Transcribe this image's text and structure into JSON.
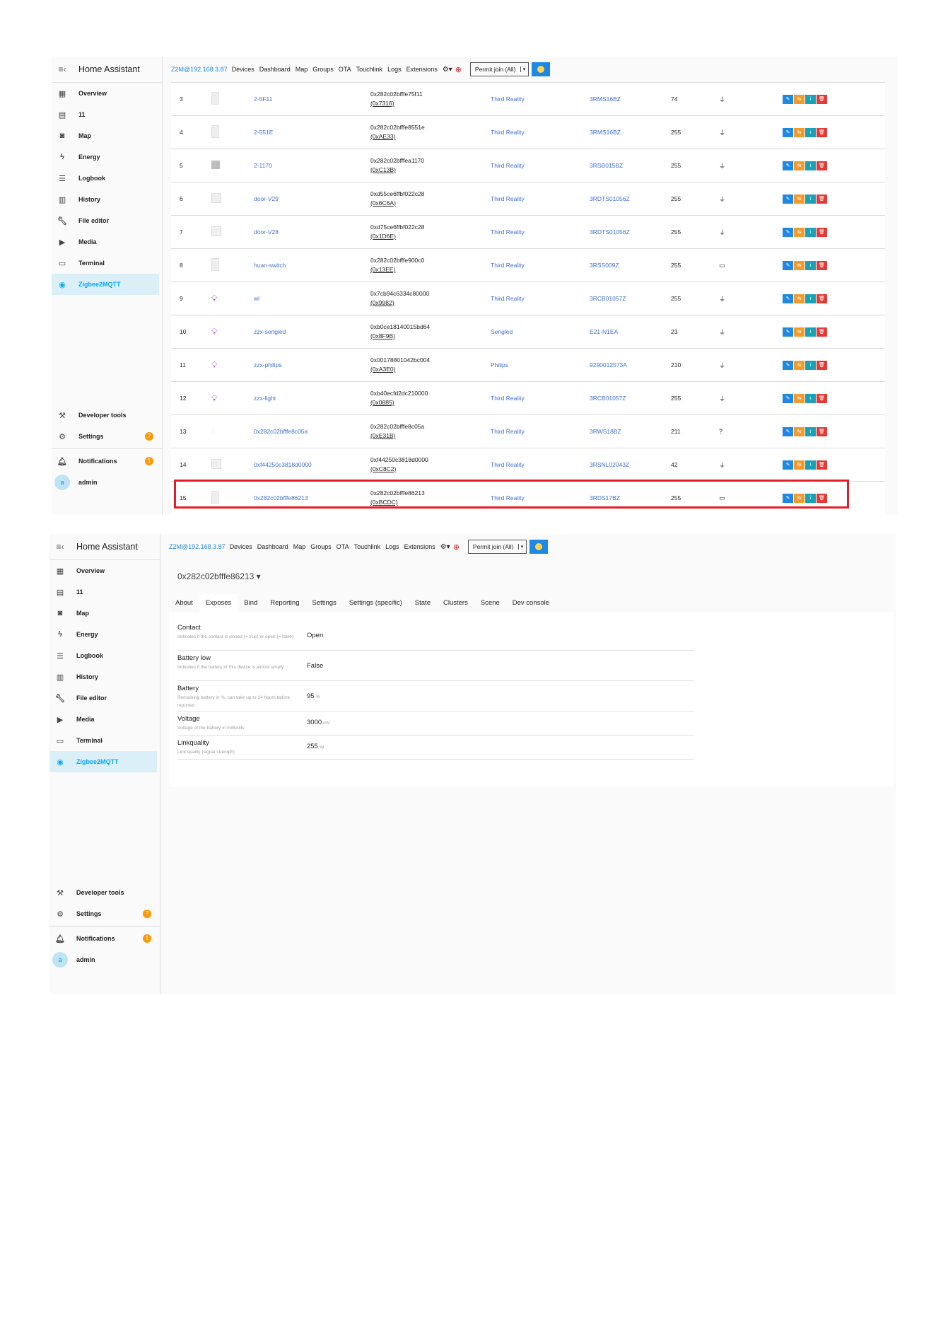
{
  "app": {
    "title": "Home Assistant",
    "brand": "Z2M@192.168.3.87",
    "nav": [
      "Devices",
      "Dashboard",
      "Map",
      "Groups",
      "OTA",
      "Touchlink",
      "Logs",
      "Extensions"
    ],
    "permit_join": "Permit join (All)"
  },
  "sidebar": {
    "items": [
      {
        "label": "Overview",
        "icon": "dashboard-icon"
      },
      {
        "label": "11",
        "icon": "notebook-icon"
      },
      {
        "label": "Map",
        "icon": "map-icon"
      },
      {
        "label": "Energy",
        "icon": "lightning-icon"
      },
      {
        "label": "Logbook",
        "icon": "list-icon"
      },
      {
        "label": "History",
        "icon": "chart-icon"
      },
      {
        "label": "File editor",
        "icon": "wrench-icon"
      },
      {
        "label": "Media",
        "icon": "media-icon"
      },
      {
        "label": "Terminal",
        "icon": "terminal-icon"
      },
      {
        "label": "Zigbee2MQTT",
        "icon": "zigbee-icon"
      }
    ],
    "developer_tools": "Developer tools",
    "settings": "Settings",
    "settings_badge": "?",
    "notifications": "Notifications",
    "notifications_badge": "1",
    "user": "admin",
    "avatar_letter": "a"
  },
  "devices": [
    {
      "idx": "3",
      "pic": "box",
      "name": "2-5F11",
      "ieee": "0x282c02bfffe75f11",
      "nwk": "(0x7316)",
      "manufacturer": "Third Reality",
      "model": "3RMS16BZ",
      "lqi": "74",
      "power": "plug"
    },
    {
      "idx": "4",
      "pic": "box",
      "name": "2-551E",
      "ieee": "0x282c02bfffe8551e",
      "nwk": "(0xAE33)",
      "manufacturer": "Third Reality",
      "model": "3RMS16BZ",
      "lqi": "255",
      "power": "plug"
    },
    {
      "idx": "5",
      "pic": "gray",
      "name": "2-1170",
      "ieee": "0x282c02bfffea1170",
      "nwk": "(0xC13B)",
      "manufacturer": "Third Reality",
      "model": "3RSB015BZ",
      "lqi": "255",
      "power": "plug"
    },
    {
      "idx": "6",
      "pic": "door",
      "name": "door-V29",
      "ieee": "0xd55ce6ffbf022c28",
      "nwk": "(0x6C6A)",
      "manufacturer": "Third Reality",
      "model": "3RDTS01056Z",
      "lqi": "255",
      "power": "plug"
    },
    {
      "idx": "7",
      "pic": "door",
      "name": "door-V28",
      "ieee": "0xd75ce6ffbf022c28",
      "nwk": "(0x1D6E)",
      "manufacturer": "Third Reality",
      "model": "3RDTS01056Z",
      "lqi": "255",
      "power": "plug"
    },
    {
      "idx": "8",
      "pic": "box",
      "name": "huan-switch",
      "ieee": "0x282c02bfffe900c0",
      "nwk": "(0x13EE)",
      "manufacturer": "Third Reality",
      "model": "3RSS009Z",
      "lqi": "255",
      "power": "battery"
    },
    {
      "idx": "9",
      "pic": "bulb",
      "name": "wl",
      "ieee": "0x7cb94c6334c80000",
      "nwk": "(0x9982)",
      "manufacturer": "Third Reality",
      "model": "3RCB01057Z",
      "lqi": "255",
      "power": "plug"
    },
    {
      "idx": "10",
      "pic": "bulb",
      "name": "zzx-sengled",
      "ieee": "0xb0ce18140015bd64",
      "nwk": "(0x8F9B)",
      "manufacturer": "Sengled",
      "model": "E21-N1EA",
      "lqi": "23",
      "power": "plug"
    },
    {
      "idx": "11",
      "pic": "bulb",
      "name": "zzx-philips",
      "ieee": "0x00178801042bc004",
      "nwk": "(0xA3E0)",
      "manufacturer": "Philips",
      "model": "9290012573A",
      "lqi": "210",
      "power": "plug"
    },
    {
      "idx": "12",
      "pic": "bulb",
      "name": "zzx-light",
      "ieee": "0xb40ecfd2dc210000",
      "nwk": "(0x0885)",
      "manufacturer": "Third Reality",
      "model": "3RCB01057Z",
      "lqi": "255",
      "power": "plug"
    },
    {
      "idx": "13",
      "pic": "drop",
      "name": "0x282c02bfffe8c05a",
      "ieee": "0x282c02bfffe8c05a",
      "nwk": "(0xE31B)",
      "manufacturer": "Third Reality",
      "model": "3RWS18BZ",
      "lqi": "211",
      "power": "?"
    },
    {
      "idx": "14",
      "pic": "door",
      "name": "0xf44250c3818d0000",
      "ieee": "0xf44250c3818d0000",
      "nwk": "(0xC8C2)",
      "manufacturer": "Third Reality",
      "model": "3RSNL02043Z",
      "lqi": "42",
      "power": "plug"
    },
    {
      "idx": "15",
      "pic": "box",
      "name": "0x282c02bfffe86213",
      "ieee": "0x282c02bfffe86213",
      "nwk": "(0xBCDC)",
      "manufacturer": "Third Reality",
      "model": "3RDS17BZ",
      "lqi": "255",
      "power": "battery"
    }
  ],
  "exposes_view": {
    "device": "0x282c02bfffe86213",
    "tabs": [
      "About",
      "Exposes",
      "Bind",
      "Reporting",
      "Settings",
      "Settings (specific)",
      "State",
      "Clusters",
      "Scene",
      "Dev console"
    ],
    "active_tab": "Exposes",
    "rows": [
      {
        "name": "Contact",
        "desc": "Indicates if the contact is closed (= true) or open (= false)",
        "value": "Open",
        "unit": ""
      },
      {
        "name": "Battery low",
        "desc": "Indicates if the battery of this device is almost empty",
        "value": "False",
        "unit": ""
      },
      {
        "name": "Battery",
        "desc": "Remaining battery in %, can take up to 24 hours before reported",
        "value": "95",
        "unit": "%"
      },
      {
        "name": "Voltage",
        "desc": "Voltage of the battery in millivolts",
        "value": "3000",
        "unit": "mV"
      },
      {
        "name": "Linkquality",
        "desc": "Link quality (signal strength)",
        "value": "255",
        "unit": "lqi"
      }
    ]
  },
  "colors": {
    "accent": "#03a9f4",
    "link": "#3f6fd1",
    "highlight": "#e41e26",
    "badge": "#ff9800"
  }
}
